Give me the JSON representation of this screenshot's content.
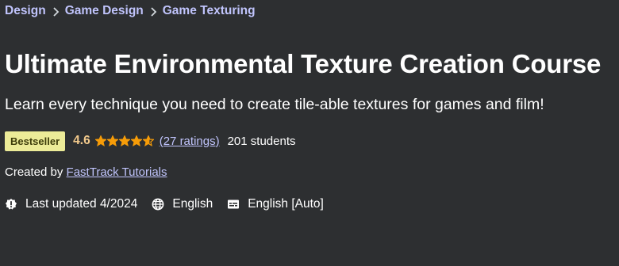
{
  "breadcrumb": {
    "items": [
      "Design",
      "Game Design",
      "Game Texturing"
    ]
  },
  "course": {
    "title": "Ultimate Environmental Texture Creation Course",
    "subtitle": "Learn every technique you need to create tile-able textures for games and film!",
    "badge": "Bestseller",
    "rating": "4.6",
    "stars_value": 4.6,
    "stars_max": 5,
    "ratings_count": "(27 ratings)",
    "students": "201 students",
    "created_by_label": "Created by",
    "author": "FastTrack Tutorials",
    "last_updated": "Last updated 4/2024",
    "language": "English",
    "captions": "English [Auto]"
  },
  "colors": {
    "background": "#2d2f31",
    "link": "#c0c4fc",
    "rating": "#f3ca8c",
    "star": "#f69c08",
    "badge_bg": "#eceb98"
  },
  "icons": {
    "breadcrumb_separator": "chevron-right-icon",
    "updated": "alert-badge-icon",
    "language": "globe-icon",
    "captions": "closed-captions-icon"
  }
}
